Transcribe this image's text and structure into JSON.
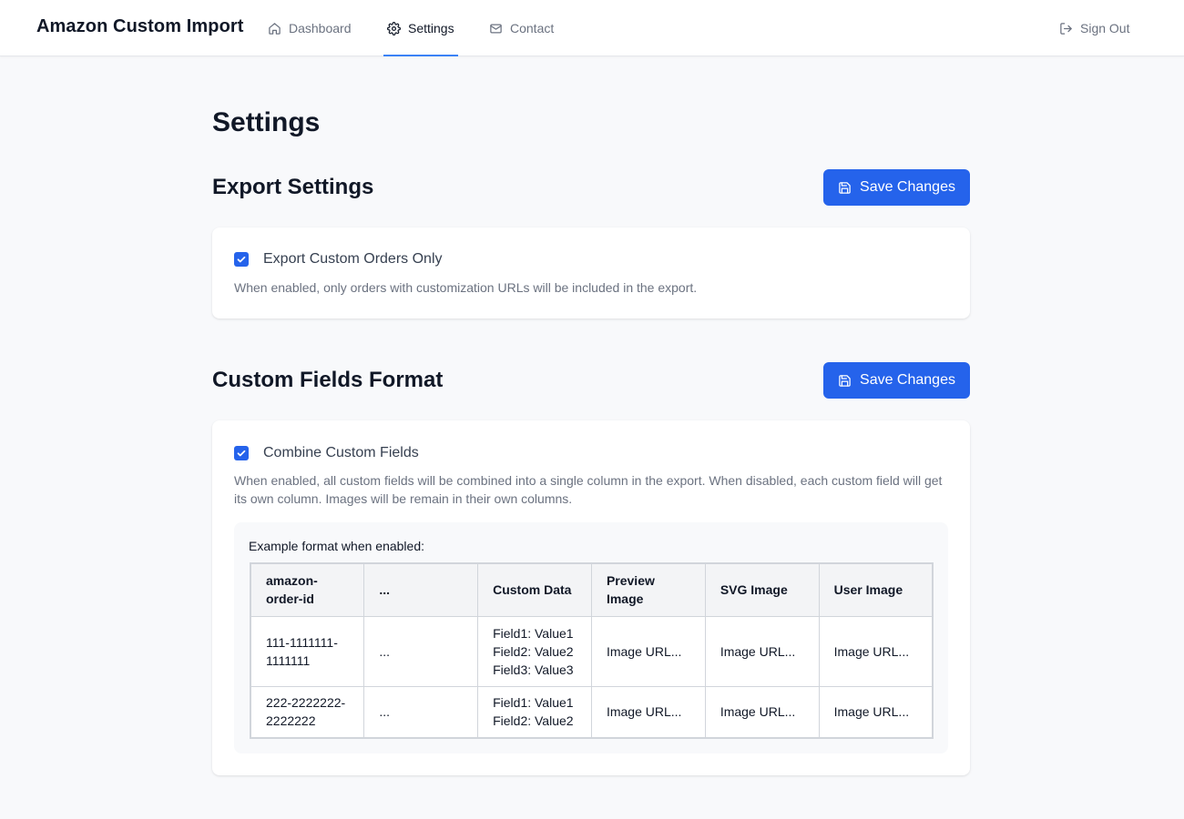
{
  "app": {
    "title": "Amazon Custom Import"
  },
  "nav": {
    "items": [
      {
        "label": "Dashboard",
        "icon": "home-icon"
      },
      {
        "label": "Settings",
        "icon": "gear-icon",
        "active": true
      },
      {
        "label": "Contact",
        "icon": "mail-icon"
      }
    ],
    "signout_label": "Sign Out"
  },
  "page": {
    "title": "Settings"
  },
  "export_settings": {
    "title": "Export Settings",
    "save_label": "Save Changes",
    "checkbox_label": "Export Custom Orders Only",
    "checked": true,
    "help": "When enabled, only orders with customization URLs will be included in the export."
  },
  "custom_fields": {
    "title": "Custom Fields Format",
    "save_label": "Save Changes",
    "checkbox_label": "Combine Custom Fields",
    "checked": true,
    "help": "When enabled, all custom fields will be combined into a single column in the export. When disabled, each custom field will get its own column. Images will be remain in their own columns.",
    "example_caption": "Example format when enabled:",
    "table": {
      "headers": [
        "amazon-order-id",
        "...",
        "Custom Data",
        "Preview Image",
        "SVG Image",
        "User Image"
      ],
      "rows": [
        [
          "111-1111111-1111111",
          "...",
          "Field1: Value1\nField2: Value2\nField3: Value3",
          "Image URL...",
          "Image URL...",
          "Image URL..."
        ],
        [
          "222-2222222-2222222",
          "...",
          "Field1: Value1\nField2: Value2",
          "Image URL...",
          "Image URL...",
          "Image URL..."
        ]
      ]
    }
  },
  "colors": {
    "primary": "#2563eb",
    "active_underline": "#3b82f6",
    "background": "#f8f9fb",
    "text_muted": "#6b7280"
  }
}
